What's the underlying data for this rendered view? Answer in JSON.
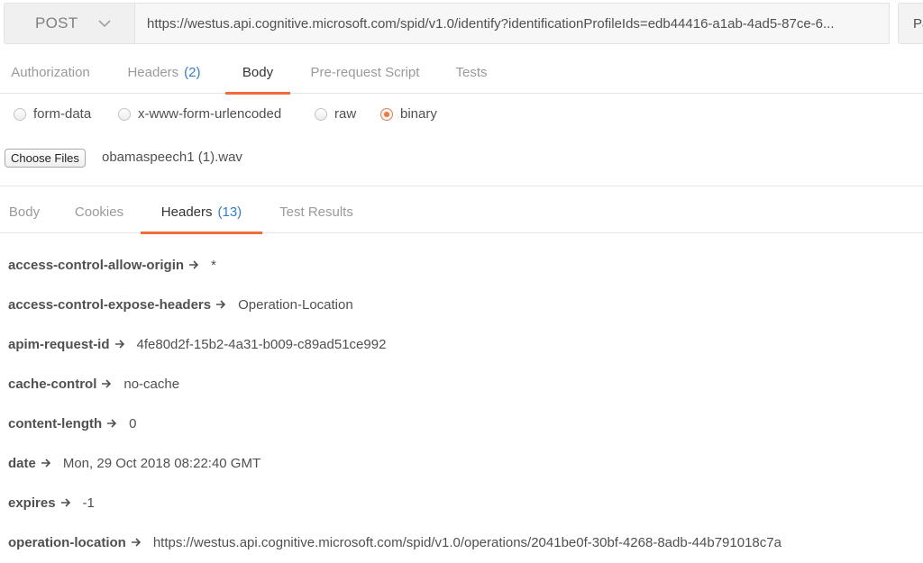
{
  "request": {
    "method": "POST",
    "url": "https://westus.api.cognitive.microsoft.com/spid/v1.0/identify?identificationProfileIds=edb44416-a1ab-4ad5-87ce-6...",
    "params_label": "Pa",
    "tabs": [
      {
        "label": "Authorization",
        "count": ""
      },
      {
        "label": "Headers",
        "count": "(2)"
      },
      {
        "label": "Body",
        "count": ""
      },
      {
        "label": "Pre-request Script",
        "count": ""
      },
      {
        "label": "Tests",
        "count": ""
      }
    ],
    "active_tab": "Body",
    "body_types": [
      "form-data",
      "x-www-form-urlencoded",
      "raw",
      "binary"
    ],
    "selected_body_type": "binary",
    "choose_files_label": "Choose Files",
    "file_name": "obamaspeech1 (1).wav"
  },
  "response": {
    "tabs": [
      {
        "label": "Body",
        "count": ""
      },
      {
        "label": "Cookies",
        "count": ""
      },
      {
        "label": "Headers",
        "count": "(13)"
      },
      {
        "label": "Test Results",
        "count": ""
      }
    ],
    "active_tab": "Headers",
    "headers": [
      {
        "key": "access-control-allow-origin",
        "value": "*"
      },
      {
        "key": "access-control-expose-headers",
        "value": "Operation-Location"
      },
      {
        "key": "apim-request-id",
        "value": "4fe80d2f-15b2-4a31-b009-c89ad51ce992"
      },
      {
        "key": "cache-control",
        "value": "no-cache"
      },
      {
        "key": "content-length",
        "value": "0"
      },
      {
        "key": "date",
        "value": "Mon, 29 Oct 2018 08:22:40 GMT"
      },
      {
        "key": "expires",
        "value": "-1"
      },
      {
        "key": "operation-location",
        "value": "https://westus.api.cognitive.microsoft.com/spid/v1.0/operations/2041be0f-30bf-4268-8adb-44b791018c7a"
      }
    ]
  },
  "icons": {
    "method_dropdown": "chevron-down-icon",
    "header_arrow": "arrow-right-icon"
  },
  "colors": {
    "accent_tab_underline": "#f26b3a",
    "count_blue": "#2f7dd8",
    "radio_selected": "#f0783c"
  }
}
